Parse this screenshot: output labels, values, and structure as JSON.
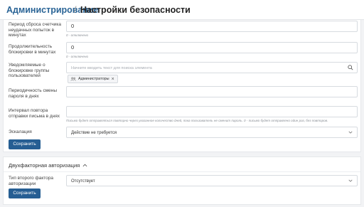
{
  "header": {
    "breadcrumb_parent": "Администрирование",
    "separator": "/",
    "title": "Настройки безопасности"
  },
  "security": {
    "reset_period": {
      "label": "Период сброса счетчика неудачных попыток в минутах",
      "value": "0",
      "hint": "0 - отключено"
    },
    "lockout_duration": {
      "label": "Продолжительность блокировки в минутах",
      "value": "0",
      "hint": "0 - отключено"
    },
    "notify_group": {
      "label": "Уведомляемые о блокировке группы пользователей",
      "placeholder": "Начните вводить текст для поиска элемента",
      "tag": "Администраторы"
    },
    "password_change": {
      "label": "Периодичность смены пароля в днях",
      "value": ""
    },
    "repeat_interval": {
      "label": "Интервал повтора отправки письма в днях",
      "value": "",
      "hint": "Письмо будет отправляться повторно через указанное количество дней, пока пользователь не сменит пароль. 0 - письмо будет отправлено один раз, без повторов."
    },
    "escalation": {
      "label": "Эскалация",
      "value": "Действие не требуется"
    },
    "save_label": "Сохранить"
  },
  "two_factor": {
    "title": "Двухфакторная авторизация",
    "factor_type": {
      "label": "Тип второго фактора авторизации",
      "value": "Отсутствует"
    },
    "save_label": "Сохранить"
  },
  "colors": {
    "accent": "#265e93",
    "link": "#2a6496",
    "background": "#f2f3f5"
  }
}
